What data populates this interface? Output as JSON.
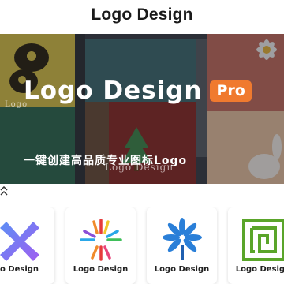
{
  "header": {
    "title": "Logo Design"
  },
  "banner": {
    "title": "Logo Design",
    "badge": "Pro",
    "subtitle": "一键创建高品质专业图标Logo",
    "tile_caption": "Logo Design",
    "tile_caption_small": "Logo"
  },
  "templates": [
    {
      "label": "o Design",
      "icon": "x-gradient-logo-icon"
    },
    {
      "label": "Logo Design",
      "icon": "rainbow-burst-logo-icon"
    },
    {
      "label": "Logo Design",
      "icon": "blue-flower-logo-icon"
    },
    {
      "label": "Logo Design",
      "icon": "green-maze-logo-icon"
    }
  ],
  "colors": {
    "accent": "#f07a2f",
    "banner_bg": "#3a3f47"
  }
}
